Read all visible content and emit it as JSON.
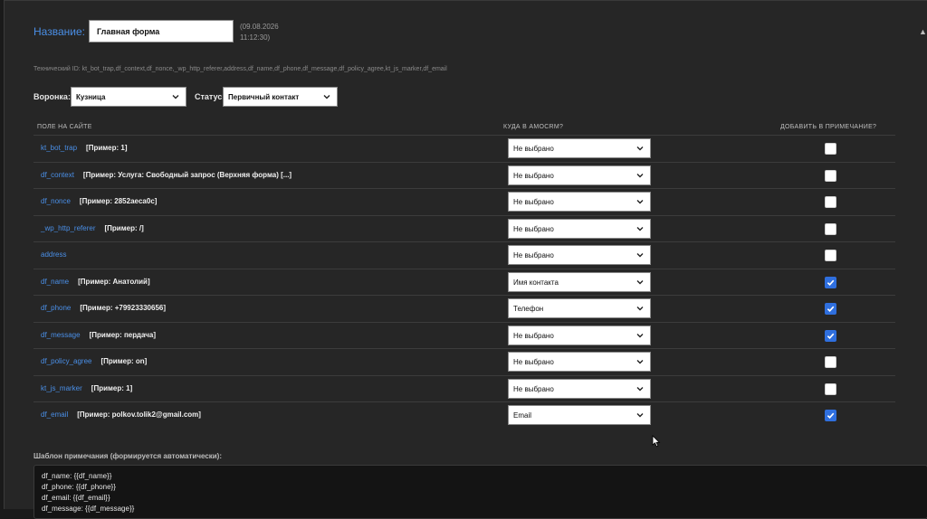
{
  "form": {
    "title_label": "Название:",
    "title_value": "Главная форма",
    "date_line1": "(09.08.2026",
    "date_line2": "11:12:30)",
    "collapse_glyph": "▲",
    "tech_id": "Технический ID: kt_bot_trap,df_context,df_nonce,_wp_http_referer,address,df_name,df_phone,df_message,df_policy_agree,kt_js_marker,df_email"
  },
  "controls": {
    "funnel_label": "Воронка:",
    "funnel_value": "Кузница",
    "status_label": "Статус:",
    "status_value": "Первичный контакт"
  },
  "table": {
    "headers": {
      "field": "ПОЛЕ НА САЙТЕ",
      "target": "КУДА В AMOCRM?",
      "note": "ДОБАВИТЬ В ПРИМЕЧАНИЕ?"
    },
    "rows": [
      {
        "field": "kt_bot_trap",
        "example": "[Пример: 1]",
        "target": "Не выбрано",
        "checked": false
      },
      {
        "field": "df_context",
        "example": "[Пример: Услуга: Свободный запрос (Верхняя форма) [...]",
        "target": "Не выбрано",
        "checked": false
      },
      {
        "field": "df_nonce",
        "example": "[Пример: 2852aeca0c]",
        "target": "Не выбрано",
        "checked": false
      },
      {
        "field": "_wp_http_referer",
        "example": "[Пример: /]",
        "target": "Не выбрано",
        "checked": false
      },
      {
        "field": "address",
        "example": "",
        "target": "Не выбрано",
        "checked": false
      },
      {
        "field": "df_name",
        "example": "[Пример: Анатолий]",
        "target": "Имя контакта",
        "checked": true
      },
      {
        "field": "df_phone",
        "example": "[Пример: +79923330656]",
        "target": "Телефон",
        "checked": true
      },
      {
        "field": "df_message",
        "example": "[Пример: пердача]",
        "target": "Не выбрано",
        "checked": true
      },
      {
        "field": "df_policy_agree",
        "example": "[Пример: on]",
        "target": "Не выбрано",
        "checked": false
      },
      {
        "field": "kt_js_marker",
        "example": "[Пример: 1]",
        "target": "Не выбрано",
        "checked": false
      },
      {
        "field": "df_email",
        "example": "[Пример: polkov.tolik2@gmail.com]",
        "target": "Email",
        "checked": true
      }
    ]
  },
  "note": {
    "label": "Шаблон примечания (формируется автоматически):",
    "text": "df_name: {{df_name}}\ndf_phone: {{df_phone}}\ndf_email: {{df_email}}\ndf_message: {{df_message}}"
  },
  "colors": {
    "accent": "#4a8fe7",
    "checkbox_on": "#2f6fde",
    "panel": "#262626"
  }
}
